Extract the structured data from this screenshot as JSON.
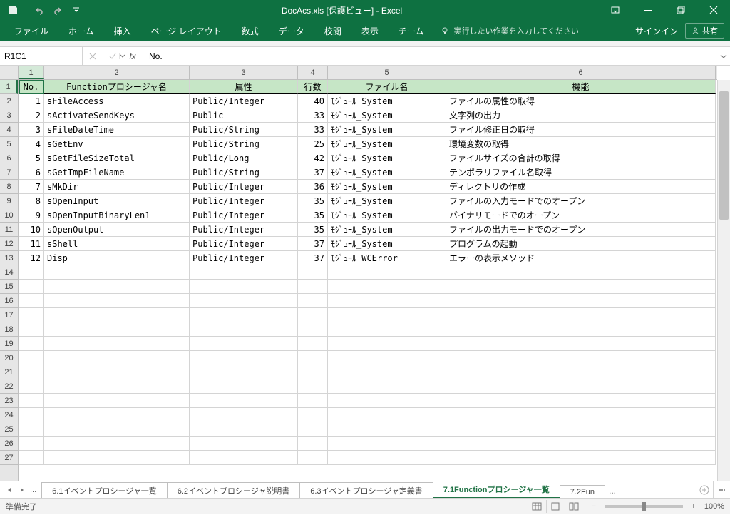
{
  "title": "DocAcs.xls [保護ビュー] - Excel",
  "qat": {
    "save": "save",
    "undo": "undo",
    "redo": "redo"
  },
  "win": {
    "ribbon_opts": "ribbon-display-options",
    "min": "minimize",
    "max": "restore",
    "close": "close"
  },
  "tabs": {
    "file": "ファイル",
    "home": "ホーム",
    "insert": "挿入",
    "layout": "ページ レイアウト",
    "formulas": "数式",
    "data": "データ",
    "review": "校閲",
    "view": "表示",
    "team": "チーム"
  },
  "tellme": "実行したい作業を入力してください",
  "signin": "サインイン",
  "share": "共有",
  "namebox": "R1C1",
  "formula": "No.",
  "colhdrs": [
    "1",
    "2",
    "3",
    "4",
    "5",
    "6"
  ],
  "rowhdrs": [
    "1",
    "2",
    "3",
    "4",
    "5",
    "6",
    "7",
    "8",
    "9",
    "10",
    "11",
    "12",
    "13",
    "14",
    "15",
    "16",
    "17",
    "18",
    "19",
    "20",
    "21",
    "22",
    "23",
    "24",
    "25",
    "26",
    "27"
  ],
  "header": {
    "c1": "No.",
    "c2": "Functionプロシージャ名",
    "c3": "属性",
    "c4": "行数",
    "c5": "ファイル名",
    "c6": "機能"
  },
  "rows": [
    {
      "c1": "1",
      "c2": "sFileAccess",
      "c3": "Public/Integer",
      "c4": "40",
      "c5": "ﾓｼﾞｭｰﾙ_System",
      "c6": "ファイルの属性の取得"
    },
    {
      "c1": "2",
      "c2": "sActivateSendKeys",
      "c3": "Public",
      "c4": "33",
      "c5": "ﾓｼﾞｭｰﾙ_System",
      "c6": "文字列の出力"
    },
    {
      "c1": "3",
      "c2": "sFileDateTime",
      "c3": "Public/String",
      "c4": "33",
      "c5": "ﾓｼﾞｭｰﾙ_System",
      "c6": "ファイル修正日の取得"
    },
    {
      "c1": "4",
      "c2": "sGetEnv",
      "c3": "Public/String",
      "c4": "25",
      "c5": "ﾓｼﾞｭｰﾙ_System",
      "c6": "環境変数の取得"
    },
    {
      "c1": "5",
      "c2": "sGetFileSizeTotal",
      "c3": "Public/Long",
      "c4": "42",
      "c5": "ﾓｼﾞｭｰﾙ_System",
      "c6": "ファイルサイズの合計の取得"
    },
    {
      "c1": "6",
      "c2": "sGetTmpFileName",
      "c3": "Public/String",
      "c4": "37",
      "c5": "ﾓｼﾞｭｰﾙ_System",
      "c6": "テンポラリファイル名取得"
    },
    {
      "c1": "7",
      "c2": "sMkDir",
      "c3": "Public/Integer",
      "c4": "36",
      "c5": "ﾓｼﾞｭｰﾙ_System",
      "c6": "ディレクトリの作成"
    },
    {
      "c1": "8",
      "c2": "sOpenInput",
      "c3": "Public/Integer",
      "c4": "35",
      "c5": "ﾓｼﾞｭｰﾙ_System",
      "c6": "ファイルの入力モードでのオープン"
    },
    {
      "c1": "9",
      "c2": "sOpenInputBinaryLen1",
      "c3": "Public/Integer",
      "c4": "35",
      "c5": "ﾓｼﾞｭｰﾙ_System",
      "c6": "バイナリモードでのオープン"
    },
    {
      "c1": "10",
      "c2": "sOpenOutput",
      "c3": "Public/Integer",
      "c4": "35",
      "c5": "ﾓｼﾞｭｰﾙ_System",
      "c6": "ファイルの出力モードでのオープン"
    },
    {
      "c1": "11",
      "c2": "sShell",
      "c3": "Public/Integer",
      "c4": "37",
      "c5": "ﾓｼﾞｭｰﾙ_System",
      "c6": "プログラムの起動"
    },
    {
      "c1": "12",
      "c2": "Disp",
      "c3": "Public/Integer",
      "c4": "37",
      "c5": "ﾓｼﾞｭｰﾙ_WCError",
      "c6": "エラーの表示メソッド"
    }
  ],
  "sheets": {
    "ellips": "...",
    "t1": "6.1イベントプロシージャ一覧",
    "t2": "6.2イベントプロシージャ説明書",
    "t3": "6.3イベントプロシージャ定義書",
    "t4": "7.1Functionプロシージャ一覧",
    "t5": "7.2Fun",
    "ellips2": "..."
  },
  "status": {
    "ready": "準備完了",
    "zoom": "100%"
  }
}
